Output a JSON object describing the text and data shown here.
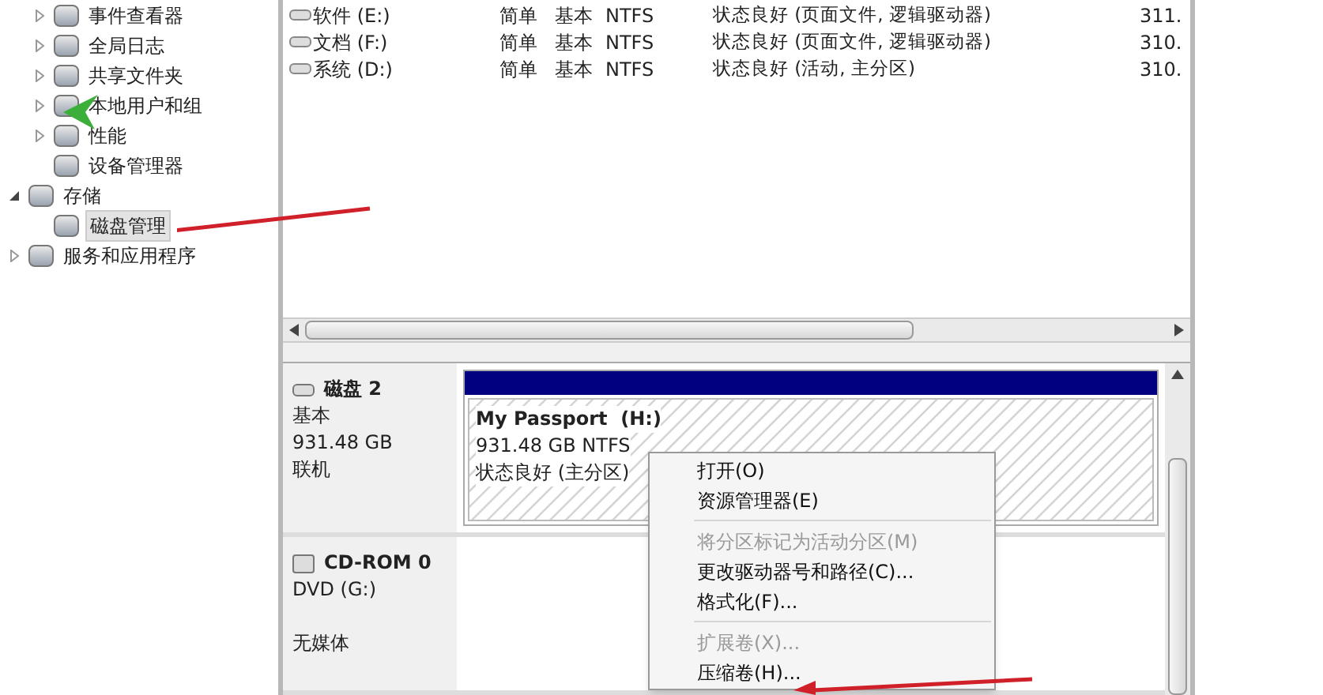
{
  "tree": [
    {
      "children": [
        {
          "label": "事件查看器",
          "expanded": false,
          "selected": false
        },
        {
          "label": "全局日志",
          "expanded": false,
          "selected": false
        },
        {
          "label": "共享文件夹",
          "expanded": false,
          "selected": false
        },
        {
          "label": "本地用户和组",
          "expanded": false,
          "selected": false
        },
        {
          "label": "性能",
          "expanded": false,
          "selected": false
        },
        {
          "label": "设备管理器",
          "selected": false
        }
      ]
    },
    {
      "label": "存储",
      "expanded": true,
      "selected": false,
      "children": [
        {
          "label": "磁盘管理",
          "selected": true
        }
      ]
    },
    {
      "label": "服务和应用程序",
      "expanded": false,
      "selected": false
    }
  ],
  "volumes": [
    {
      "name": "软件 (E:)",
      "layout": "简单",
      "type": "基本",
      "fs": "NTFS",
      "status": "状态良好 (页面文件, 逻辑驱动器)",
      "capacity": "311."
    },
    {
      "name": "文档 (F:)",
      "layout": "简单",
      "type": "基本",
      "fs": "NTFS",
      "status": "状态良好 (页面文件, 逻辑驱动器)",
      "capacity": "310."
    },
    {
      "name": "系统 (D:)",
      "layout": "简单",
      "type": "基本",
      "fs": "NTFS",
      "status": "状态良好 (活动, 主分区)",
      "capacity": "310."
    }
  ],
  "disks": [
    {
      "kind": "disk",
      "name": "磁盘 2",
      "lines": [
        "基本",
        "931.48 GB",
        "联机"
      ],
      "partition": {
        "name": "My Passport  (H:)",
        "size": "931.48 GB NTFS",
        "status": "状态良好 (主分区)"
      }
    },
    {
      "kind": "cdrom",
      "name": "CD-ROM 0",
      "lines": [
        "DVD (G:)",
        "无媒体"
      ]
    }
  ],
  "context_menu": [
    {
      "label": "打开(O)",
      "disabled": false
    },
    {
      "label": "资源管理器(E)",
      "disabled": false,
      "separator_after": true
    },
    {
      "label": "将分区标记为活动分区(M)",
      "disabled": true
    },
    {
      "label": "更改驱动器号和路径(C)...",
      "disabled": false
    },
    {
      "label": "格式化(F)...",
      "disabled": false,
      "separator_after": true
    },
    {
      "label": "扩展卷(X)...",
      "disabled": true
    },
    {
      "label": "压缩卷(H)...",
      "disabled": false
    }
  ]
}
